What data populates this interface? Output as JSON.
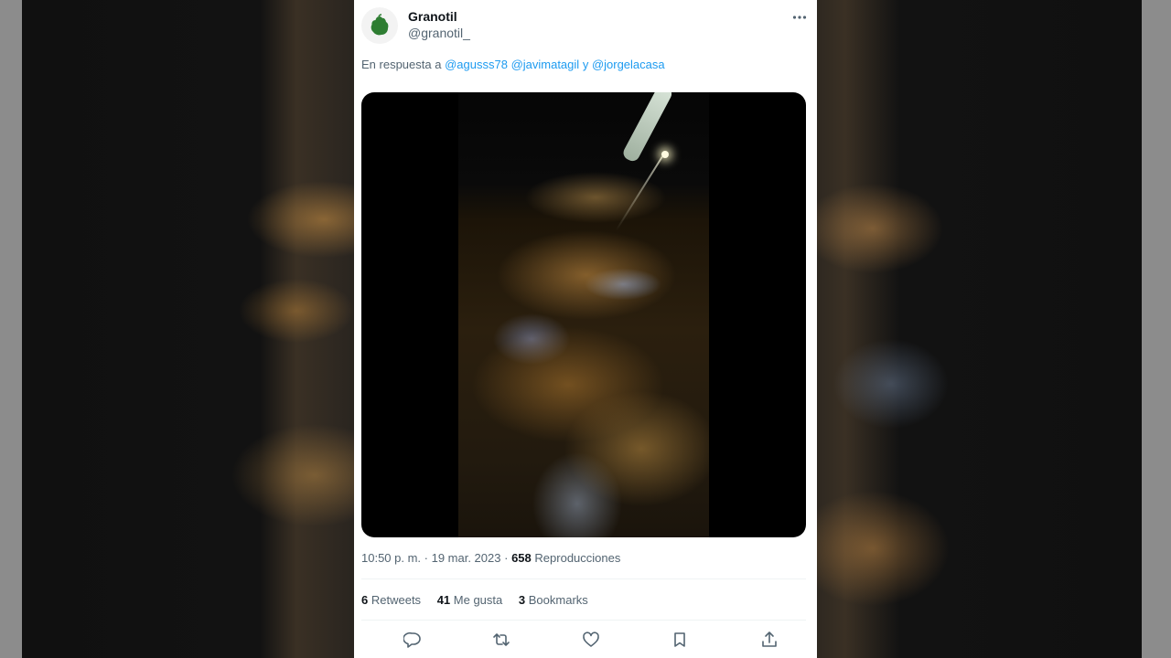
{
  "tweet": {
    "author": {
      "name": "Granotil",
      "handle": "@granotil_",
      "avatar_color": "#2e7d32"
    },
    "reply_to": {
      "prefix": "En respuesta a",
      "mentions": [
        "@agusss78",
        "@javimatagil"
      ],
      "conjunction": "y",
      "last_mention": "@jorgelacasa"
    },
    "timestamp": "10:50 p. m. · 19 mar. 2023",
    "views": {
      "count": "658",
      "label": "Reproducciones"
    },
    "stats": {
      "retweets": {
        "count": "6",
        "label": "Retweets"
      },
      "likes": {
        "count": "41",
        "label": "Me gusta"
      },
      "bookmarks": {
        "count": "3",
        "label": "Bookmarks"
      }
    },
    "icons": {
      "more": "more-dots-icon",
      "reply": "reply-icon",
      "retweet": "retweet-icon",
      "like": "heart-icon",
      "bookmark": "bookmark-icon",
      "share": "share-icon"
    },
    "colors": {
      "mention": "#1d9bf0",
      "secondary_text": "#536471",
      "primary_text": "#0f1419"
    }
  }
}
